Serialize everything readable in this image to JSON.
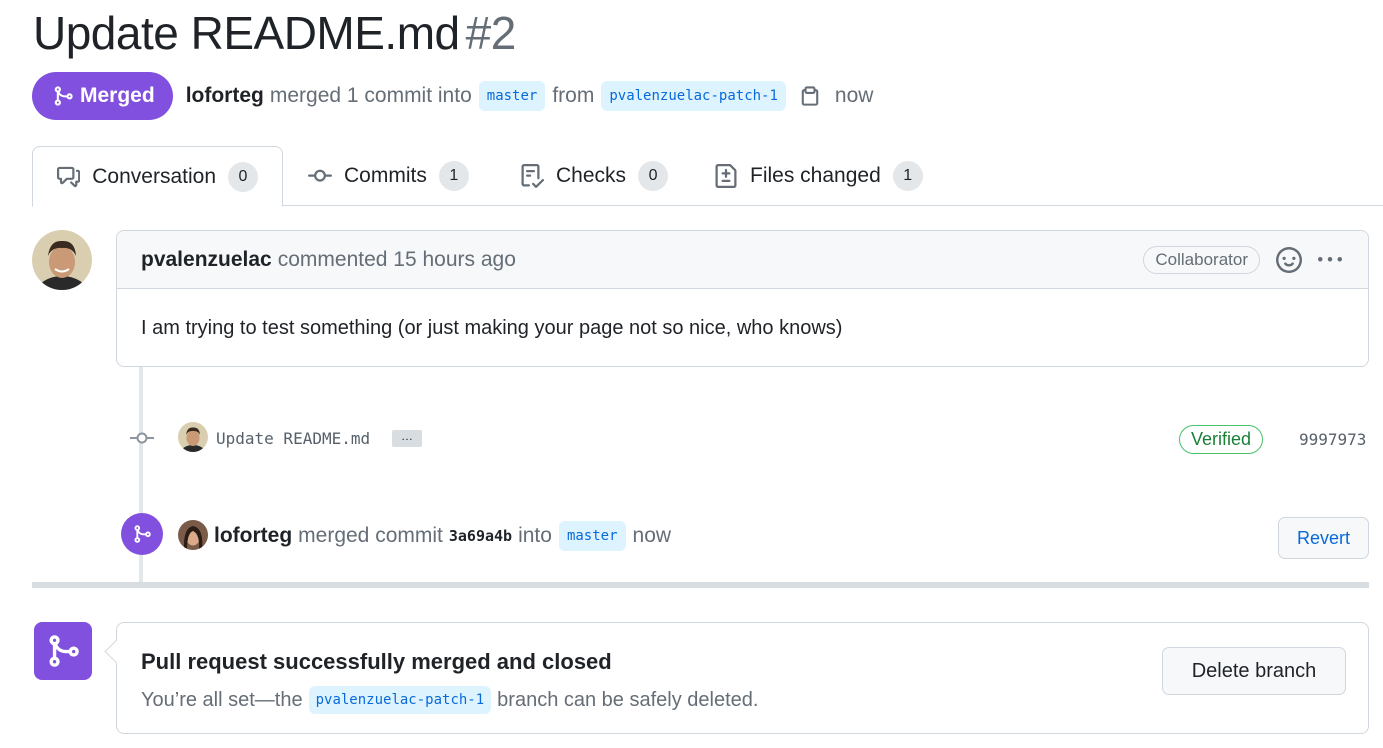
{
  "pr": {
    "title": "Update README.md",
    "number": "#2"
  },
  "meta": {
    "state": "Merged",
    "author": "loforteg",
    "action": "merged 1 commit into",
    "base_branch": "master",
    "from_text": "from",
    "head_branch": "pvalenzuelac-patch-1",
    "time": "now"
  },
  "tabs": [
    {
      "label": "Conversation",
      "count": "0",
      "icon": "comment-discussion-icon"
    },
    {
      "label": "Commits",
      "count": "1",
      "icon": "git-commit-icon"
    },
    {
      "label": "Checks",
      "count": "0",
      "icon": "checklist-icon"
    },
    {
      "label": "Files changed",
      "count": "1",
      "icon": "file-diff-icon"
    }
  ],
  "comment": {
    "author": "pvalenzuelac",
    "action": "commented 15 hours ago",
    "role": "Collaborator",
    "body": "I am trying to test something (or just making your page not so nice, who knows)"
  },
  "commit": {
    "message": "Update README.md",
    "ellipsis": "…",
    "verified": "Verified",
    "sha": "9997973"
  },
  "merge_event": {
    "author": "loforteg",
    "action": "merged commit",
    "sha": "3a69a4b",
    "into": "into",
    "branch": "master",
    "time": "now",
    "revert_label": "Revert"
  },
  "merged_box": {
    "title": "Pull request successfully merged and closed",
    "sub_prefix": "You’re all set—the",
    "branch": "pvalenzuelac-patch-1",
    "sub_suffix": "branch can be safely deleted.",
    "delete_label": "Delete branch"
  },
  "colors": {
    "merged_purple": "#8250df",
    "link_blue": "#0969da",
    "verified_green": "#1a7f37"
  }
}
